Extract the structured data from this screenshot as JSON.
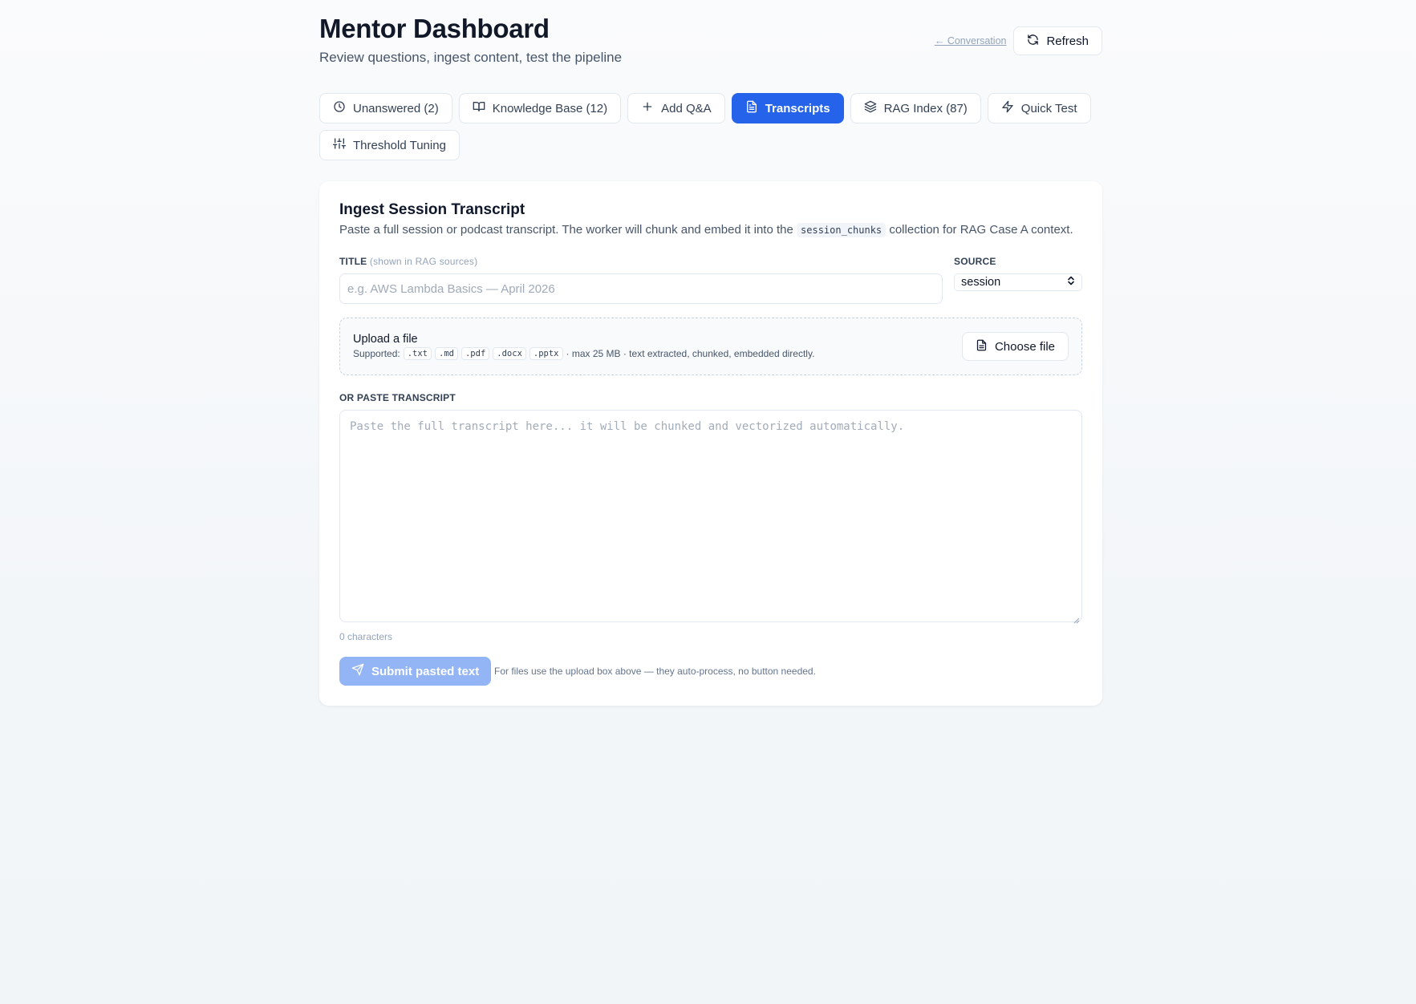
{
  "header": {
    "title": "Mentor Dashboard",
    "subtitle": "Review questions, ingest content, test the pipeline",
    "conversation_link": "← Conversation",
    "refresh_label": "Refresh"
  },
  "tabs": [
    {
      "label": "Unanswered (2)",
      "icon": "clock-icon",
      "active": false
    },
    {
      "label": "Knowledge Base (12)",
      "icon": "book-open-icon",
      "active": false
    },
    {
      "label": "Add Q&A",
      "icon": "plus-icon",
      "active": false
    },
    {
      "label": "Transcripts",
      "icon": "file-text-icon",
      "active": true
    },
    {
      "label": "RAG Index (87)",
      "icon": "layers-icon",
      "active": false
    },
    {
      "label": "Quick Test",
      "icon": "zap-icon",
      "active": false
    },
    {
      "label": "Threshold Tuning",
      "icon": "sliders-icon",
      "active": false
    }
  ],
  "ingest": {
    "title": "Ingest Session Transcript",
    "desc_before": "Paste a full session or podcast transcript. The worker will chunk and embed it into the",
    "desc_code": "session_chunks",
    "desc_after": "collection for RAG Case A context.",
    "title_label": "TITLE",
    "title_hint": "(shown in RAG sources)",
    "title_value": "",
    "title_placeholder": "e.g. AWS Lambda Basics — April 2026",
    "source_label": "SOURCE",
    "source_value": "session",
    "upload": {
      "title": "Upload a file",
      "supported_label": "Supported:",
      "extensions": [
        ".txt",
        ".md",
        ".pdf",
        ".docx",
        ".pptx"
      ],
      "note": "· max 25 MB · text extracted, chunked, embedded directly.",
      "choose_label": "Choose file"
    },
    "paste_label": "OR PASTE TRANSCRIPT",
    "transcript_value": "",
    "transcript_placeholder": "Paste the full transcript here... it will be chunked and vectorized automatically.",
    "char_count": "0 characters",
    "submit_label": "Submit pasted text",
    "submit_note": "For files use the upload box above — they auto-process, no button needed."
  },
  "colors": {
    "accent": "#2563eb",
    "accent_disabled": "#93b4f5",
    "background": "#f3f6f9"
  }
}
